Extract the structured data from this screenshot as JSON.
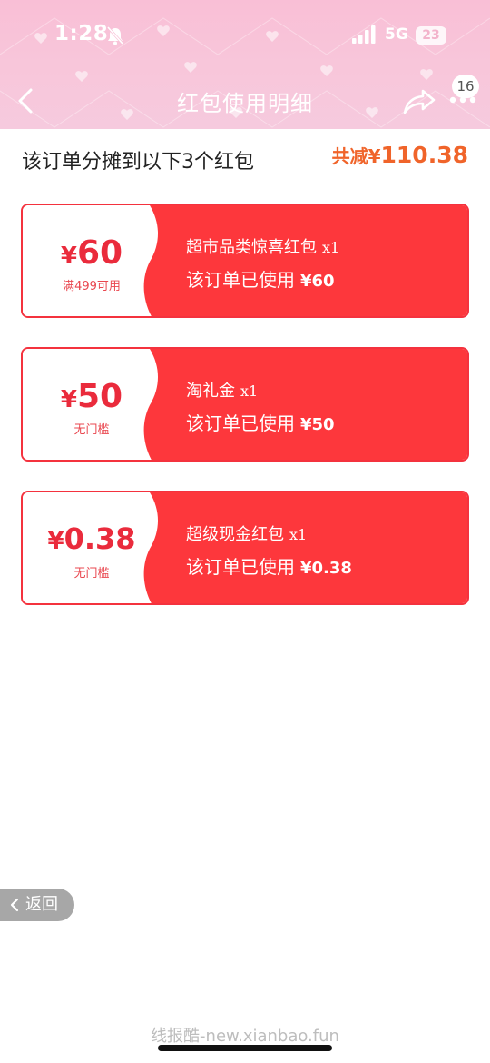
{
  "status_bar": {
    "time": "1:28",
    "network": "5G",
    "battery": "23",
    "mute_icon": "bell-slash-icon",
    "signal_icon": "signal-bars-icon"
  },
  "nav": {
    "title": "红包使用明细",
    "back_icon": "chevron-left-icon",
    "share_icon": "share-icon",
    "more_icon": "more-dots-icon",
    "more_badge": "16"
  },
  "summary": {
    "text": "该订单分摊到以下3个红包",
    "total_label": "共减¥",
    "total_amount": "110.38"
  },
  "coupons": [
    {
      "symbol": "¥",
      "amount": "60",
      "condition": "满499可用",
      "name": "超市品类惊喜红包",
      "qty": "x1",
      "used_label": "该订单已使用",
      "used_value": "¥60"
    },
    {
      "symbol": "¥",
      "amount": "50",
      "condition": "无门槛",
      "name": "淘礼金",
      "qty": "x1",
      "used_label": "该订单已使用",
      "used_value": "¥50"
    },
    {
      "symbol": "¥",
      "amount": "0.38",
      "condition": "无门槛",
      "name": "超级现金红包",
      "qty": "x1",
      "used_label": "该订单已使用",
      "used_value": "¥0.38"
    }
  ],
  "float_back": {
    "label": "返回",
    "icon": "chevron-left-icon"
  },
  "watermark": "线报酷-new.xianbao.fun",
  "colors": {
    "accent_red": "#fd373c",
    "total_orange": "#f0642a",
    "header_pink": "#f9bfd6"
  }
}
